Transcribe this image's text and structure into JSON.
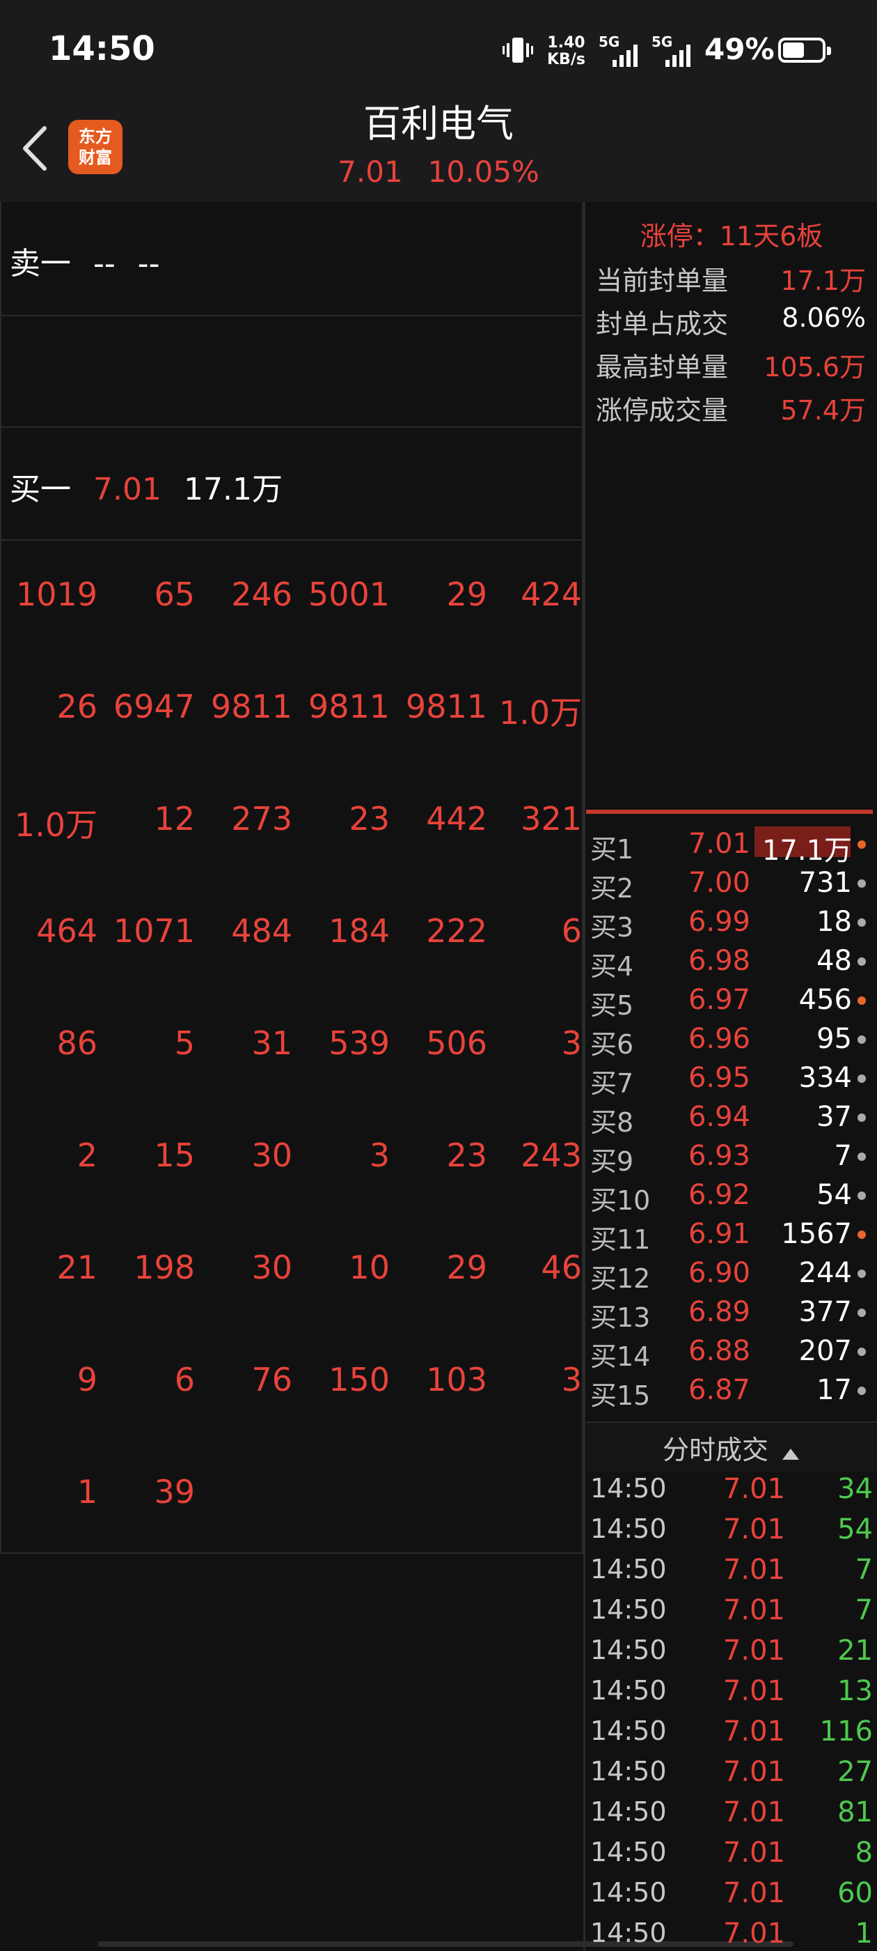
{
  "status": {
    "time": "14:50",
    "speed_top": "1.40",
    "speed_unit": "KB/s",
    "sim1": "5G",
    "sim2": "5G",
    "battery": "49%"
  },
  "header": {
    "logo_line1": "东方",
    "logo_line2": "财富",
    "stock_name": "百利电气",
    "price": "7.01",
    "change_pct": "10.05%"
  },
  "orderbook": {
    "sell1_label": "卖一",
    "sell1_price": "--",
    "sell1_vol": "--",
    "buy1_label": "买一",
    "buy1_price": "7.01",
    "buy1_vol": "17.1万"
  },
  "queue_grid": [
    [
      "1019",
      "65",
      "246",
      "5001",
      "29",
      "424"
    ],
    [
      "26",
      "6947",
      "9811",
      "9811",
      "9811",
      "1.0万"
    ],
    [
      "1.0万",
      "12",
      "273",
      "23",
      "442",
      "321"
    ],
    [
      "464",
      "1071",
      "484",
      "184",
      "222",
      "6"
    ],
    [
      "86",
      "5",
      "31",
      "539",
      "506",
      "3"
    ],
    [
      "2",
      "15",
      "30",
      "3",
      "23",
      "243"
    ],
    [
      "21",
      "198",
      "30",
      "10",
      "29",
      "46"
    ],
    [
      "9",
      "6",
      "76",
      "150",
      "103",
      "3"
    ],
    [
      "1",
      "39"
    ]
  ],
  "limit_stats": {
    "title": "涨停：11天6板",
    "rows": [
      {
        "label": "当前封单量",
        "value": "17.1万",
        "color": "#e8433a"
      },
      {
        "label": "封单占成交",
        "value": "8.06%",
        "color": "#ffffff"
      },
      {
        "label": "最高封单量",
        "value": "105.6万",
        "color": "#e8433a"
      },
      {
        "label": "涨停成交量",
        "value": "57.4万",
        "color": "#e8433a"
      }
    ]
  },
  "bid_levels": [
    {
      "label": "买1",
      "price": "7.01",
      "vol": "17.1万",
      "dot": "#e8662a"
    },
    {
      "label": "买2",
      "price": "7.00",
      "vol": "731",
      "dot": "#aaaaaa"
    },
    {
      "label": "买3",
      "price": "6.99",
      "vol": "18",
      "dot": "#aaaaaa"
    },
    {
      "label": "买4",
      "price": "6.98",
      "vol": "48",
      "dot": "#aaaaaa"
    },
    {
      "label": "买5",
      "price": "6.97",
      "vol": "456",
      "dot": "#e8662a"
    },
    {
      "label": "买6",
      "price": "6.96",
      "vol": "95",
      "dot": "#aaaaaa"
    },
    {
      "label": "买7",
      "price": "6.95",
      "vol": "334",
      "dot": "#aaaaaa"
    },
    {
      "label": "买8",
      "price": "6.94",
      "vol": "37",
      "dot": "#aaaaaa"
    },
    {
      "label": "买9",
      "price": "6.93",
      "vol": "7",
      "dot": "#aaaaaa"
    },
    {
      "label": "买10",
      "price": "6.92",
      "vol": "54",
      "dot": "#aaaaaa"
    },
    {
      "label": "买11",
      "price": "6.91",
      "vol": "1567",
      "dot": "#e8662a"
    },
    {
      "label": "买12",
      "price": "6.90",
      "vol": "244",
      "dot": "#aaaaaa"
    },
    {
      "label": "买13",
      "price": "6.89",
      "vol": "377",
      "dot": "#aaaaaa"
    },
    {
      "label": "买14",
      "price": "6.88",
      "vol": "207",
      "dot": "#aaaaaa"
    },
    {
      "label": "买15",
      "price": "6.87",
      "vol": "17",
      "dot": "#aaaaaa"
    }
  ],
  "trades": {
    "title": "分时成交",
    "rows": [
      {
        "time": "14:50",
        "price": "7.01",
        "vol": "34"
      },
      {
        "time": "14:50",
        "price": "7.01",
        "vol": "54"
      },
      {
        "time": "14:50",
        "price": "7.01",
        "vol": "7"
      },
      {
        "time": "14:50",
        "price": "7.01",
        "vol": "7"
      },
      {
        "time": "14:50",
        "price": "7.01",
        "vol": "21"
      },
      {
        "time": "14:50",
        "price": "7.01",
        "vol": "13"
      },
      {
        "time": "14:50",
        "price": "7.01",
        "vol": "116"
      },
      {
        "time": "14:50",
        "price": "7.01",
        "vol": "27"
      },
      {
        "time": "14:50",
        "price": "7.01",
        "vol": "81"
      },
      {
        "time": "14:50",
        "price": "7.01",
        "vol": "8"
      },
      {
        "time": "14:50",
        "price": "7.01",
        "vol": "60"
      },
      {
        "time": "14:50",
        "price": "7.01",
        "vol": "1"
      }
    ]
  },
  "colors": {
    "up_red": "#e8433a",
    "down_green": "#4ec94e",
    "brand_orange": "#e55a1f"
  }
}
